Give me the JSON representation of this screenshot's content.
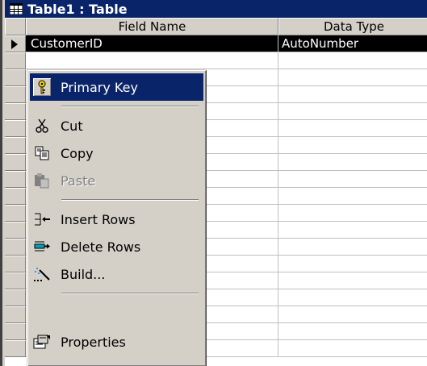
{
  "window": {
    "title": "Table1 : Table"
  },
  "grid": {
    "columns": [
      "Field Name",
      "Data Type"
    ],
    "rows": [
      {
        "field": "CustomerID",
        "type": "AutoNumber"
      }
    ]
  },
  "context_menu": {
    "items": [
      {
        "label": "Primary Key",
        "icon": "key-icon"
      },
      {
        "label": "Cut",
        "icon": "scissors-icon"
      },
      {
        "label": "Copy",
        "icon": "copy-icon"
      },
      {
        "label": "Paste",
        "icon": "paste-icon"
      },
      {
        "label": "Insert Rows",
        "icon": "insert-rows-icon"
      },
      {
        "label": "Delete Rows",
        "icon": "delete-rows-icon"
      },
      {
        "label": "Build...",
        "icon": "build-wand-icon"
      },
      {
        "label": "Properties",
        "icon": "properties-icon"
      }
    ]
  },
  "colors": {
    "title_bar": "#0a246a",
    "face": "#d4d0c8",
    "highlight": "#0a246a"
  }
}
